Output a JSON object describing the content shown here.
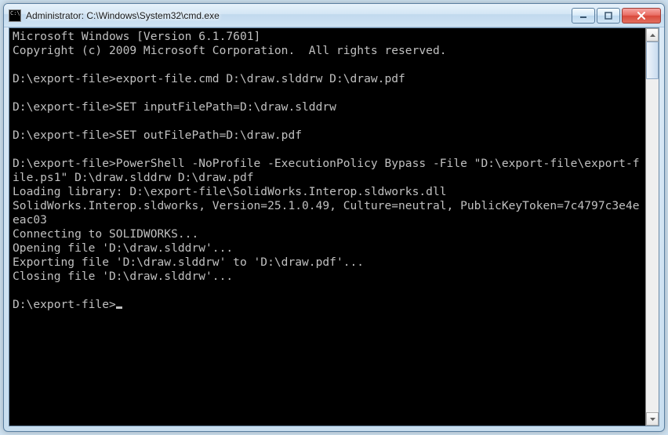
{
  "window": {
    "title": "Administrator: C:\\Windows\\System32\\cmd.exe"
  },
  "terminal": {
    "lines": [
      "Microsoft Windows [Version 6.1.7601]",
      "Copyright (c) 2009 Microsoft Corporation.  All rights reserved.",
      "",
      "D:\\export-file>export-file.cmd D:\\draw.slddrw D:\\draw.pdf",
      "",
      "D:\\export-file>SET inputFilePath=D:\\draw.slddrw",
      "",
      "D:\\export-file>SET outFilePath=D:\\draw.pdf",
      "",
      "D:\\export-file>PowerShell -NoProfile -ExecutionPolicy Bypass -File \"D:\\export-file\\export-file.ps1\" D:\\draw.slddrw D:\\draw.pdf",
      "Loading library: D:\\export-file\\SolidWorks.Interop.sldworks.dll",
      "SolidWorks.Interop.sldworks, Version=25.1.0.49, Culture=neutral, PublicKeyToken=7c4797c3e4eeac03",
      "Connecting to SOLIDWORKS...",
      "Opening file 'D:\\draw.slddrw'...",
      "Exporting file 'D:\\draw.slddrw' to 'D:\\draw.pdf'...",
      "Closing file 'D:\\draw.slddrw'...",
      "",
      "D:\\export-file>"
    ]
  }
}
